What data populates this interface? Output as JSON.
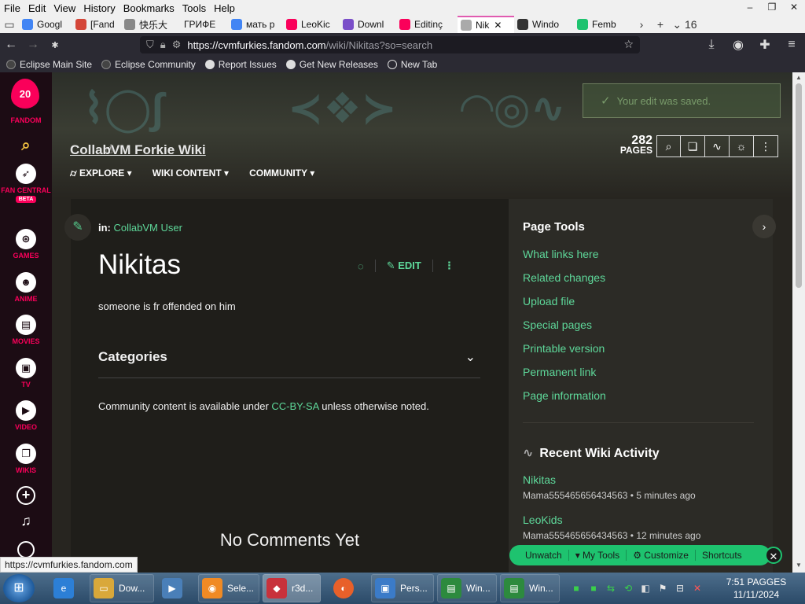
{
  "menubar": {
    "items": [
      "File",
      "Edit",
      "View",
      "History",
      "Bookmarks",
      "Tools",
      "Help"
    ],
    "window_controls": [
      "–",
      "❐",
      "✕"
    ]
  },
  "tabs": [
    {
      "label": "Googl",
      "color": "#4285f4"
    },
    {
      "label": "[Fand",
      "color": "#d44638"
    },
    {
      "label": "快乐大",
      "color": "#888888"
    },
    {
      "label": "ГРИФЕ",
      "color": "#f0f0f0"
    },
    {
      "label": "мать р",
      "color": "#4285f4"
    },
    {
      "label": "LeoKic",
      "color": "#fa005a"
    },
    {
      "label": "Downl",
      "color": "#7b4fc9"
    },
    {
      "label": "Editinç",
      "color": "#fa005a"
    },
    {
      "label": "Nik",
      "color": "#aaaaaa",
      "active": true
    },
    {
      "label": "Windo",
      "color": "#333333"
    },
    {
      "label": "Femb",
      "color": "#1ec36f"
    }
  ],
  "tab_controls": {
    "scroll": "›",
    "new": "+",
    "list_count": "16"
  },
  "address_bar": {
    "host": "https://cvmfurkies.fandom.com",
    "path": "/wiki/Nikitas?so=search"
  },
  "bookmarks": [
    {
      "label": "Eclipse Main Site",
      "color": "#444"
    },
    {
      "label": "Eclipse Community",
      "color": "#444"
    },
    {
      "label": "Report Issues",
      "color": "#ddd"
    },
    {
      "label": "Get New Releases",
      "color": "#ddd"
    },
    {
      "label": "New Tab",
      "color": "#ddd"
    }
  ],
  "rail": {
    "logo_number": "20",
    "items": [
      "FANDOM",
      "FAN CENTRAL",
      "GAMES",
      "ANIME",
      "MOVIES",
      "TV",
      "VIDEO",
      "WIKIS"
    ],
    "beta": "BETA"
  },
  "wiki": {
    "title": "CollabVM Forkie Wiki",
    "nav": [
      "EXPLORE",
      "WIKI CONTENT",
      "COMMUNITY"
    ],
    "page_count": "282",
    "page_count_label": "PAGES"
  },
  "toast": "Your edit was saved.",
  "article": {
    "in_label": "in:",
    "category": "CollabVM User",
    "title": "Nikitas",
    "edit_label": "EDIT",
    "body": "someone is fr offended on him",
    "categories_heading": "Categories",
    "license_prefix": "Community content is available under",
    "license_link": "CC-BY-SA",
    "license_suffix": "unless otherwise noted.",
    "no_comments": "No Comments Yet"
  },
  "sidebar": {
    "page_tools_title": "Page Tools",
    "tools": [
      "What links here",
      "Related changes",
      "Upload file",
      "Special pages",
      "Printable version",
      "Permanent link",
      "Page information"
    ],
    "activity_title": "Recent Wiki Activity",
    "activity": [
      {
        "page": "Nikitas",
        "meta": "Mama555465656434563 • 5 minutes ago"
      },
      {
        "page": "LeoKids",
        "meta": "Mama555465656434563 • 12 minutes ago"
      }
    ]
  },
  "wikibar": {
    "items": [
      "Unwatch",
      "My Tools",
      "Customize",
      "Shortcuts"
    ]
  },
  "status_url": "https://cvmfurkies.fandom.com",
  "taskbar": {
    "buttons": [
      {
        "label": "Dow...",
        "color": "#d9a83a"
      },
      {
        "label": "Sele...",
        "color": "#f08a24"
      },
      {
        "label": "r3d...",
        "color": "#c8323c"
      },
      {
        "label": "Pers...",
        "color": "#3b7bc8"
      },
      {
        "label": "Win...",
        "color": "#2d8a3e"
      },
      {
        "label": "Win...",
        "color": "#2d8a3e"
      }
    ],
    "clock_time": "7:51 PAGGES",
    "clock_date": "11/11/2024"
  }
}
